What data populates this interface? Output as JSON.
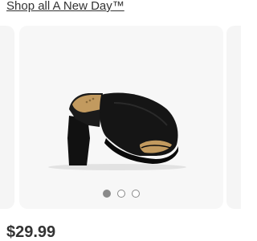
{
  "header": {
    "shop_link": "Shop all A New Day™"
  },
  "carousel": {
    "slides_count": 3,
    "active_index": 0,
    "image_icon": "black-suede-mule-heel"
  },
  "product": {
    "price": "$29.99"
  },
  "colors": {
    "text": "#333333",
    "card_bg": "#f7f7f7",
    "dot": "#8a8a8a"
  }
}
